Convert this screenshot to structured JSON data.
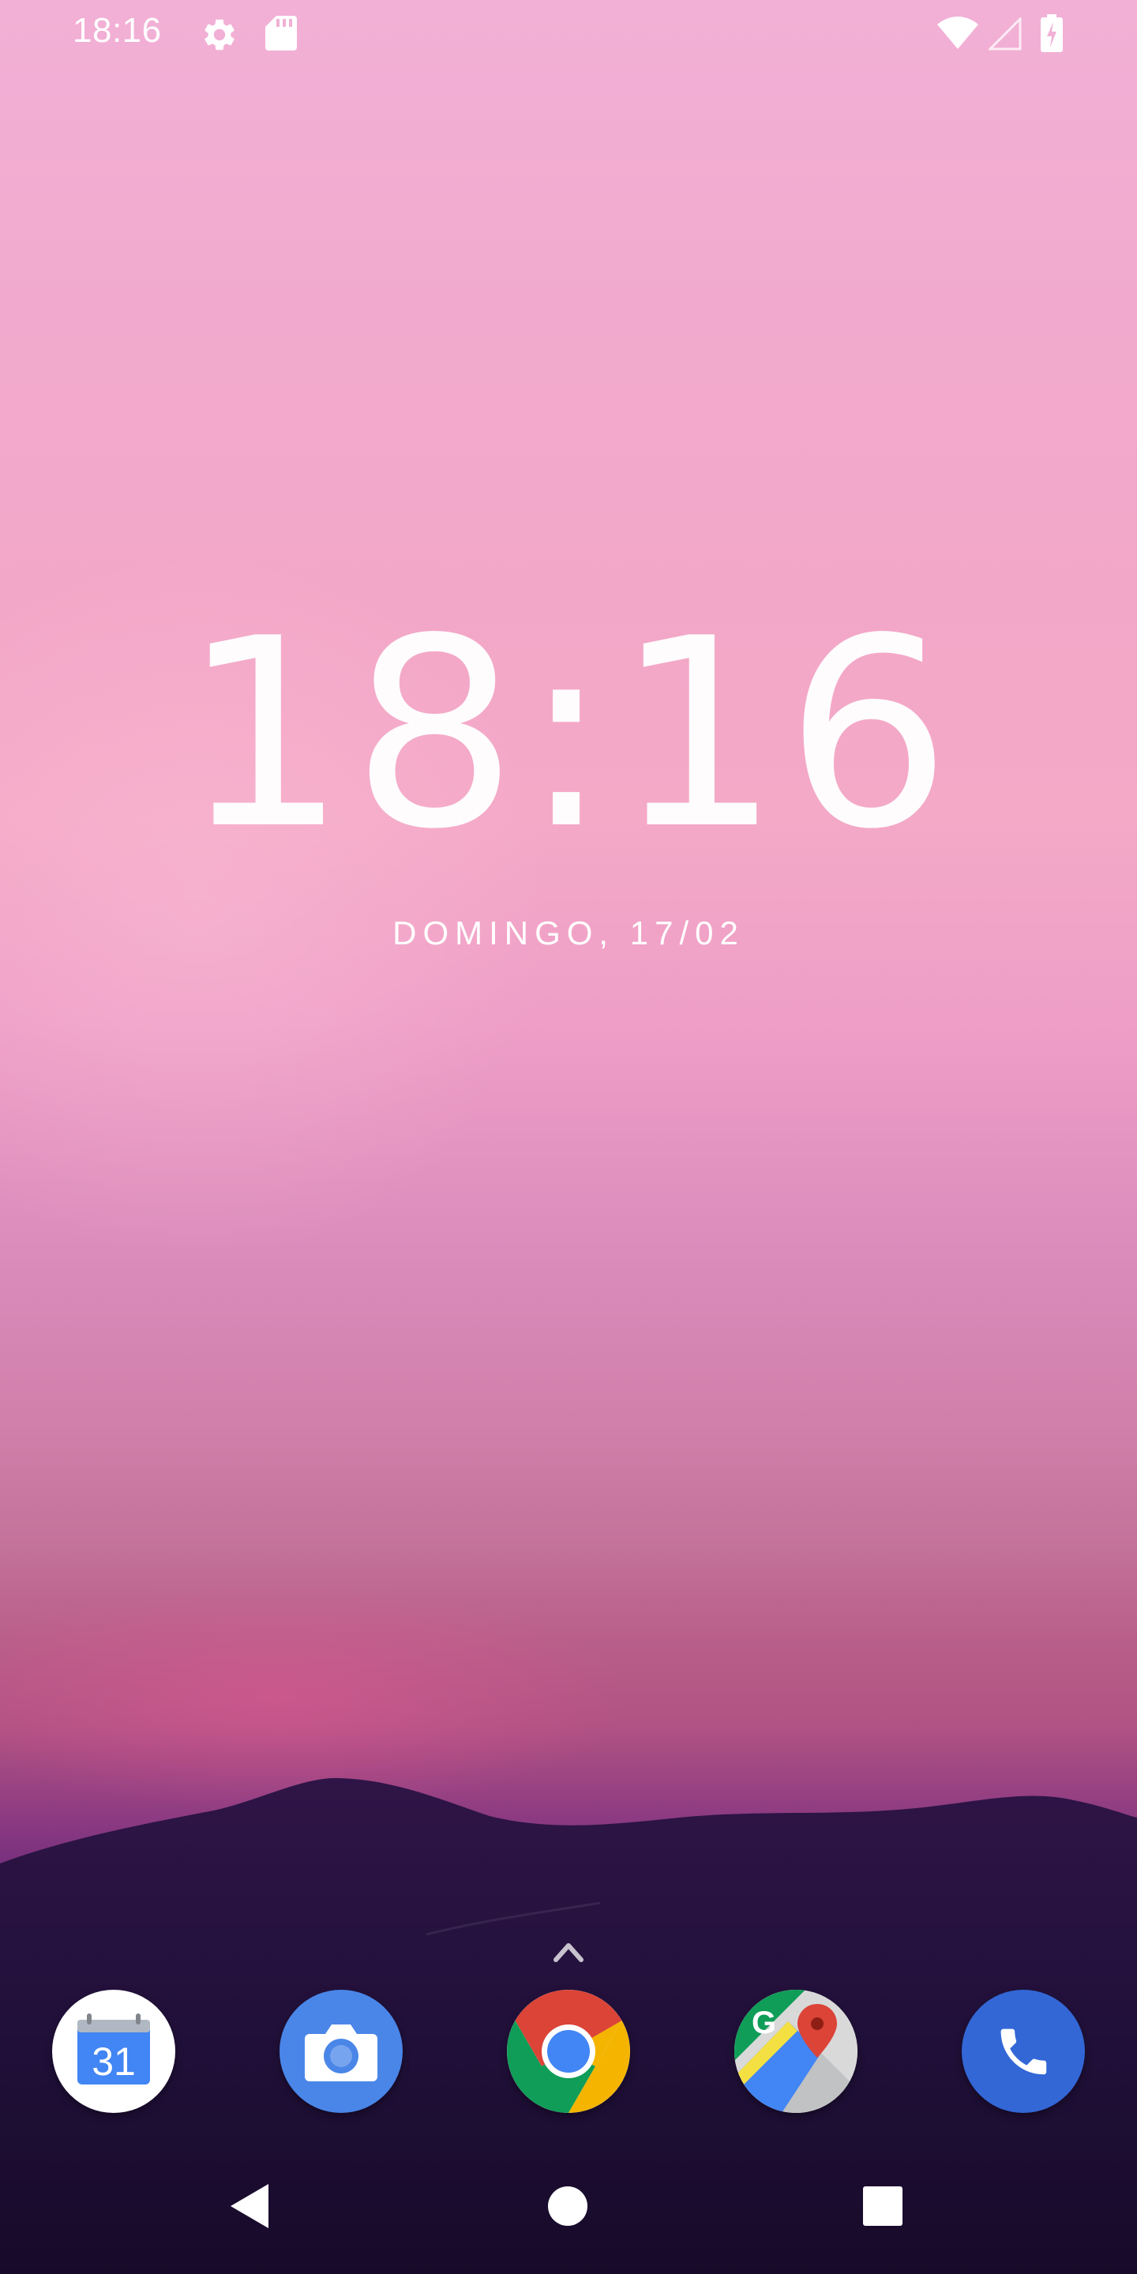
{
  "status_bar": {
    "time": "18:16",
    "icons": [
      "settings-gear-icon",
      "sd-card-icon",
      "wifi-icon",
      "cellular-signal-icon",
      "battery-charging-icon"
    ]
  },
  "lock_clock": {
    "time": "18:16",
    "date": "DOMINGO, 17/02"
  },
  "dock": {
    "apps": [
      {
        "name": "calendar",
        "icon": "calendar-icon",
        "text": "31"
      },
      {
        "name": "camera",
        "icon": "camera-icon"
      },
      {
        "name": "chrome",
        "icon": "chrome-icon"
      },
      {
        "name": "maps",
        "icon": "maps-icon",
        "text": "G"
      },
      {
        "name": "phone",
        "icon": "phone-icon"
      }
    ]
  },
  "navigation": {
    "buttons": [
      "back-icon",
      "home-icon",
      "recents-icon"
    ]
  },
  "colors": {
    "text": "#ffffff",
    "chrome_red": "#db4437",
    "chrome_green": "#0f9d58",
    "chrome_yellow": "#f4b400",
    "chrome_blue": "#4285f4",
    "phone_blue": "#3367d6"
  }
}
